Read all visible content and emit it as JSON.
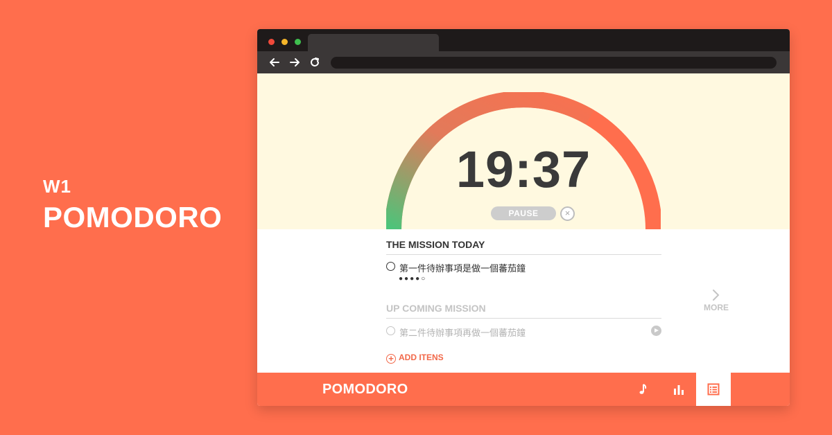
{
  "promo": {
    "subtitle": "W1",
    "title": "POMODORO"
  },
  "timer": {
    "time": "19:37",
    "pause_label": "PAUSE",
    "stop_symbol": "×",
    "progress": 0.67
  },
  "missions": {
    "today_heading": "THE MISSION TODAY",
    "today_task": {
      "text": "第一件待辦事項是做一個蕃茄鐘",
      "pomodoros_done": 4,
      "pomodoros_total": 5
    },
    "upcoming_heading": "UP COMING MISSION",
    "upcoming_task": {
      "text": "第二件待辦事項再做一個蕃茄鐘"
    },
    "more_label": "MORE",
    "add_label": "ADD ITENS",
    "add_symbol": "+"
  },
  "footer": {
    "brand": "POMODORO"
  },
  "colors": {
    "accent": "#FF6E4D",
    "ring_start": "#4CC47A",
    "hero_bg": "#FFF9E0"
  },
  "icons": {
    "nav": [
      "arrow-left-icon",
      "arrow-right-icon",
      "reload-icon"
    ],
    "footer": [
      "music-note-icon",
      "bar-chart-icon",
      "list-icon"
    ]
  }
}
